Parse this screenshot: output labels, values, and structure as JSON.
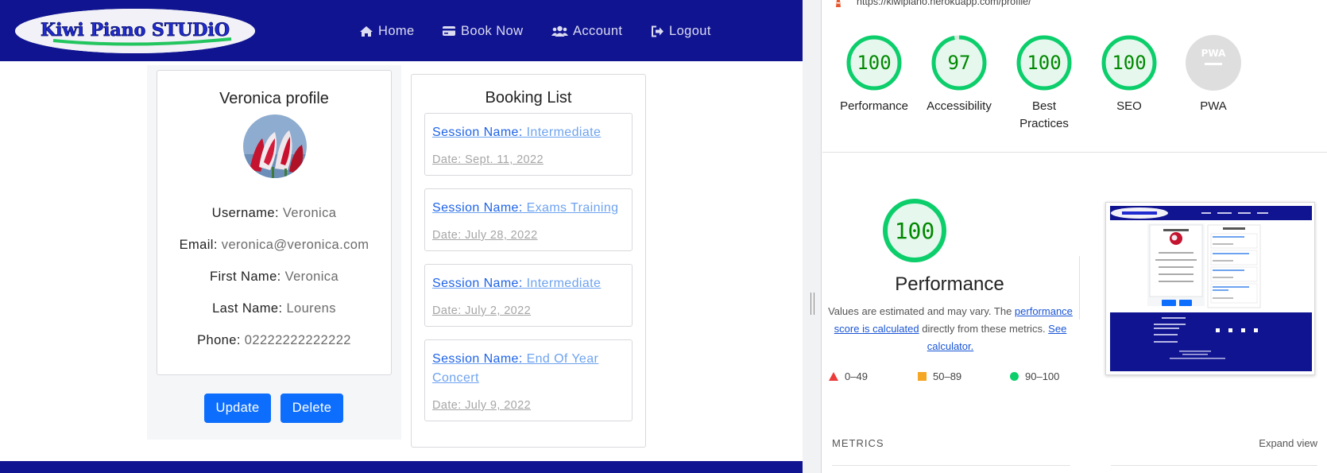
{
  "nav": {
    "logo_text": "Kiwi Piano STUDiO",
    "items": [
      {
        "label": "Home",
        "icon": "home-icon"
      },
      {
        "label": "Book Now",
        "icon": "credit-card-icon"
      },
      {
        "label": "Account",
        "icon": "users-icon"
      },
      {
        "label": "Logout",
        "icon": "sign-out-icon"
      }
    ],
    "colors": {
      "bar": "#101490",
      "link": "#dcdcf2"
    }
  },
  "profile": {
    "title": "Veronica profile",
    "avatar": "tulip-photo",
    "fields": [
      {
        "label": "Username:",
        "value": "Veronica"
      },
      {
        "label": "Email:",
        "value": "veronica@veronica.com"
      },
      {
        "label": "First Name:",
        "value": "Veronica"
      },
      {
        "label": "Last Name:",
        "value": "Lourens"
      },
      {
        "label": "Phone:",
        "value": "02222222222222"
      }
    ],
    "update_label": "Update",
    "delete_label": "Delete"
  },
  "bookings": {
    "title": "Booking List",
    "items": [
      {
        "session_label": "Session Name:",
        "session": "Intermediate",
        "date": "Date: Sept. 11, 2022"
      },
      {
        "session_label": "Session Name:",
        "session": "Exams Training",
        "date": "Date: July 28, 2022"
      },
      {
        "session_label": "Session Name:",
        "session": "Intermediate",
        "date": "Date: July 2, 2022"
      },
      {
        "session_label": "Session Name:",
        "session": "End Of Year Concert",
        "date": "Date: July 9, 2022"
      }
    ]
  },
  "lighthouse": {
    "url": "https://kiwipiano.herokuapp.com/profile/",
    "gauges": [
      {
        "label": "Performance",
        "score": "100",
        "fraction": 1.0
      },
      {
        "label": "Accessibility",
        "score": "97",
        "fraction": 0.97
      },
      {
        "label": "Best Practices",
        "score": "100",
        "fraction": 1.0
      },
      {
        "label": "SEO",
        "score": "100",
        "fraction": 1.0
      },
      {
        "label": "PWA",
        "score": "PWA",
        "fraction": null
      }
    ],
    "performance": {
      "score": "100",
      "title": "Performance",
      "desc_before": "Values are estimated and may vary. The ",
      "desc_link1": "performance score is calculated",
      "desc_middle": " directly from these metrics. ",
      "desc_link2": "See calculator."
    },
    "legend": [
      {
        "range": "0–49",
        "shape": "triangle",
        "color": "#eb3b3b"
      },
      {
        "range": "50–89",
        "shape": "square",
        "color": "#f5a623"
      },
      {
        "range": "90–100",
        "shape": "circle",
        "color": "#0cce6b"
      }
    ],
    "metrics_label": "METRICS",
    "expand_label": "Expand view",
    "colors": {
      "pass": "#0cce6b",
      "pass_text": "#008800",
      "pass_fill": "#e6f8ee"
    }
  }
}
